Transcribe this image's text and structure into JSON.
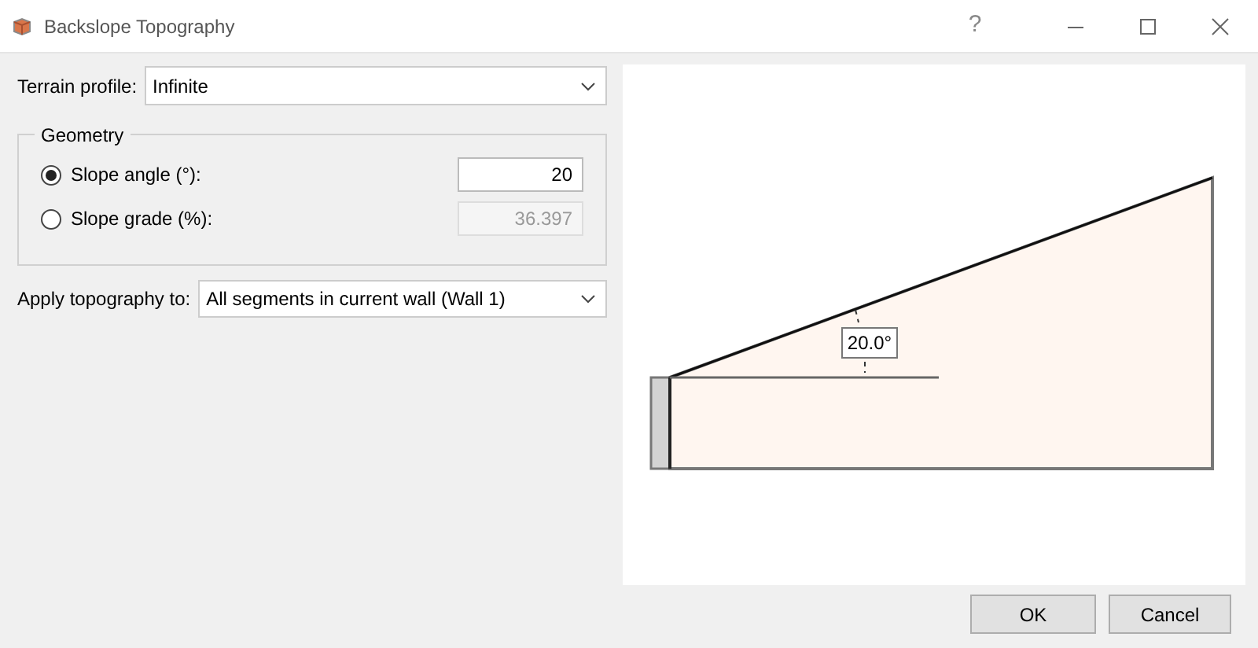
{
  "window": {
    "title": "Backslope Topography",
    "help": "?"
  },
  "terrain_profile": {
    "label": "Terrain profile:",
    "value": "Infinite"
  },
  "geometry": {
    "title": "Geometry",
    "options": [
      {
        "label": "Slope angle (°):",
        "selected": true,
        "value": "20",
        "disabled": false
      },
      {
        "label": "Slope grade (%):",
        "selected": false,
        "value": "36.397",
        "disabled": true
      }
    ]
  },
  "apply_to": {
    "label": "Apply topography to:",
    "value": "All segments in current wall (Wall 1)"
  },
  "preview": {
    "angle_label": "20.0°"
  },
  "buttons": [
    "OK",
    "Cancel"
  ]
}
